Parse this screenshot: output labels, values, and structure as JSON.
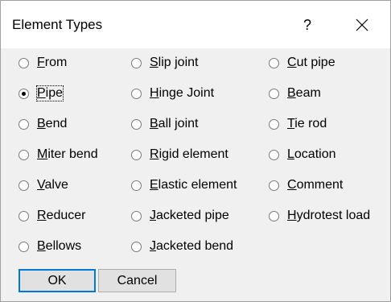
{
  "window": {
    "title": "Element Types",
    "help_label": "?",
    "close_icon": "close-icon"
  },
  "radios": [
    {
      "label": "From",
      "mnemonic": "F",
      "checked": false
    },
    {
      "label": "Pipe",
      "mnemonic": "P",
      "checked": true
    },
    {
      "label": "Bend",
      "mnemonic": "B",
      "checked": false
    },
    {
      "label": "Miter bend",
      "mnemonic": "M",
      "checked": false
    },
    {
      "label": "Valve",
      "mnemonic": "V",
      "checked": false
    },
    {
      "label": "Reducer",
      "mnemonic": "R",
      "checked": false
    },
    {
      "label": "Bellows",
      "mnemonic": "B",
      "checked": false
    },
    {
      "label": "Slip joint",
      "mnemonic": "S",
      "checked": false
    },
    {
      "label": "Hinge Joint",
      "mnemonic": "H",
      "checked": false
    },
    {
      "label": "Ball joint",
      "mnemonic": "B",
      "checked": false
    },
    {
      "label": "Rigid element",
      "mnemonic": "R",
      "checked": false
    },
    {
      "label": "Elastic element",
      "mnemonic": "E",
      "checked": false
    },
    {
      "label": "Jacketed pipe",
      "mnemonic": "J",
      "checked": false
    },
    {
      "label": "Jacketed bend",
      "mnemonic": "J",
      "checked": false
    },
    {
      "label": "Cut pipe",
      "mnemonic": "C",
      "checked": false
    },
    {
      "label": "Beam",
      "mnemonic": "B",
      "checked": false
    },
    {
      "label": "Tie rod",
      "mnemonic": "T",
      "checked": false
    },
    {
      "label": "Location",
      "mnemonic": "L",
      "checked": false
    },
    {
      "label": "Comment",
      "mnemonic": "C",
      "checked": false
    },
    {
      "label": "Hydrotest load",
      "mnemonic": "H",
      "checked": false
    }
  ],
  "buttons": {
    "ok": "OK",
    "cancel": "Cancel"
  }
}
